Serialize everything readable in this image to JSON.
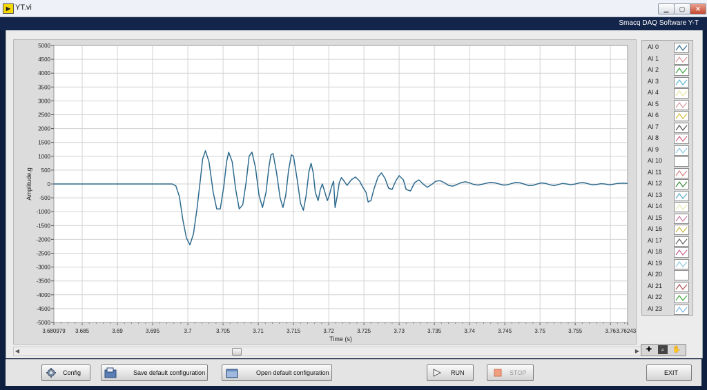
{
  "window": {
    "title": "YT.vi",
    "app_icon": "labview-vi-icon"
  },
  "header": {
    "app_name": "Smacq DAQ Software Y-T"
  },
  "chart_data": {
    "type": "line",
    "xlabel": "Time (s)",
    "ylabel": "Amplitude,g",
    "xlim": [
      3.680979,
      3.762431
    ],
    "ylim": [
      -5000,
      5000
    ],
    "x_ticks": [
      "3.680979",
      "3.685",
      "3.69",
      "3.695",
      "3.7",
      "3.705",
      "3.71",
      "3.715",
      "3.72",
      "3.725",
      "3.73",
      "3.735",
      "3.74",
      "3.745",
      "3.75",
      "3.755",
      "3.76",
      "3.762431"
    ],
    "y_ticks": [
      "5000",
      "4500",
      "4000",
      "3500",
      "3000",
      "2500",
      "2000",
      "1500",
      "1000",
      "500",
      "0",
      "-500",
      "-1000",
      "-1500",
      "-2000",
      "-2500",
      "-3000",
      "-3500",
      "-4000",
      "-4500",
      "-5000"
    ],
    "grid": true,
    "series": [
      {
        "name": "AI 0",
        "color": "#2d6a8e",
        "points": [
          [
            3.680979,
            0
          ],
          [
            3.69,
            0
          ],
          [
            3.6978,
            0
          ],
          [
            3.6983,
            -70
          ],
          [
            3.6988,
            -450
          ],
          [
            3.6993,
            -1300
          ],
          [
            3.6998,
            -1950
          ],
          [
            3.7003,
            -2200
          ],
          [
            3.7008,
            -1800
          ],
          [
            3.7013,
            -900
          ],
          [
            3.7018,
            200
          ],
          [
            3.7021,
            900
          ],
          [
            3.7025,
            1200
          ],
          [
            3.703,
            800
          ],
          [
            3.7036,
            -300
          ],
          [
            3.7041,
            -900
          ],
          [
            3.7046,
            -900
          ],
          [
            3.7051,
            -100
          ],
          [
            3.7055,
            800
          ],
          [
            3.7058,
            1150
          ],
          [
            3.7063,
            800
          ],
          [
            3.7068,
            -200
          ],
          [
            3.7073,
            -900
          ],
          [
            3.7078,
            -750
          ],
          [
            3.7083,
            100
          ],
          [
            3.7087,
            1000
          ],
          [
            3.7091,
            1150
          ],
          [
            3.7096,
            600
          ],
          [
            3.7101,
            -400
          ],
          [
            3.7106,
            -850
          ],
          [
            3.7111,
            -300
          ],
          [
            3.7115,
            600
          ],
          [
            3.7118,
            1050
          ],
          [
            3.7121,
            1100
          ],
          [
            3.7126,
            400
          ],
          [
            3.7131,
            -500
          ],
          [
            3.7135,
            -850
          ],
          [
            3.7139,
            -400
          ],
          [
            3.7143,
            500
          ],
          [
            3.7147,
            1050
          ],
          [
            3.715,
            1000
          ],
          [
            3.7155,
            200
          ],
          [
            3.716,
            -700
          ],
          [
            3.7164,
            -950
          ],
          [
            3.7168,
            -400
          ],
          [
            3.7172,
            450
          ],
          [
            3.7175,
            750
          ],
          [
            3.7178,
            400
          ],
          [
            3.7181,
            -300
          ],
          [
            3.7185,
            -600
          ],
          [
            3.7188,
            -200
          ],
          [
            3.7191,
            0
          ],
          [
            3.7194,
            -250
          ],
          [
            3.7198,
            -600
          ],
          [
            3.7201,
            -400
          ],
          [
            3.7204,
            -100
          ],
          [
            3.7207,
            100
          ],
          [
            3.7209,
            -850
          ],
          [
            3.7212,
            -450
          ],
          [
            3.7215,
            50
          ],
          [
            3.7218,
            230
          ],
          [
            3.7222,
            100
          ],
          [
            3.7226,
            -50
          ],
          [
            3.7232,
            150
          ],
          [
            3.7238,
            250
          ],
          [
            3.7244,
            100
          ],
          [
            3.7248,
            -100
          ],
          [
            3.7253,
            -300
          ],
          [
            3.7256,
            -650
          ],
          [
            3.726,
            -600
          ],
          [
            3.7264,
            -200
          ],
          [
            3.727,
            250
          ],
          [
            3.7275,
            400
          ],
          [
            3.728,
            200
          ],
          [
            3.7285,
            -150
          ],
          [
            3.729,
            -200
          ],
          [
            3.7295,
            100
          ],
          [
            3.73,
            300
          ],
          [
            3.7306,
            150
          ],
          [
            3.731,
            -200
          ],
          [
            3.7316,
            -250
          ],
          [
            3.7322,
            50
          ],
          [
            3.7328,
            150
          ],
          [
            3.7334,
            0
          ],
          [
            3.734,
            -120
          ],
          [
            3.7346,
            -20
          ],
          [
            3.7352,
            100
          ],
          [
            3.7358,
            120
          ],
          [
            3.7364,
            50
          ],
          [
            3.737,
            -50
          ],
          [
            3.7376,
            -80
          ],
          [
            3.7382,
            -20
          ],
          [
            3.7388,
            50
          ],
          [
            3.7394,
            80
          ],
          [
            3.74,
            40
          ],
          [
            3.7406,
            -20
          ],
          [
            3.7412,
            -40
          ],
          [
            3.7418,
            -10
          ],
          [
            3.7424,
            30
          ],
          [
            3.743,
            60
          ],
          [
            3.7436,
            40
          ],
          [
            3.7442,
            0
          ],
          [
            3.7448,
            -40
          ],
          [
            3.7454,
            -30
          ],
          [
            3.746,
            20
          ],
          [
            3.7466,
            60
          ],
          [
            3.7472,
            40
          ],
          [
            3.7478,
            -10
          ],
          [
            3.7484,
            -60
          ],
          [
            3.749,
            -50
          ],
          [
            3.7496,
            0
          ],
          [
            3.7502,
            40
          ],
          [
            3.7508,
            20
          ],
          [
            3.7514,
            -30
          ],
          [
            3.752,
            -60
          ],
          [
            3.7526,
            -20
          ],
          [
            3.7532,
            20
          ],
          [
            3.7538,
            0
          ],
          [
            3.7544,
            -30
          ],
          [
            3.755,
            0
          ],
          [
            3.7556,
            40
          ],
          [
            3.7562,
            50
          ],
          [
            3.7568,
            10
          ],
          [
            3.7574,
            -30
          ],
          [
            3.758,
            -20
          ],
          [
            3.7586,
            10
          ],
          [
            3.7592,
            0
          ],
          [
            3.7598,
            -30
          ],
          [
            3.7604,
            -10
          ],
          [
            3.761,
            20
          ],
          [
            3.7618,
            30
          ],
          [
            3.762431,
            20
          ]
        ]
      }
    ]
  },
  "legend": {
    "channels": [
      {
        "name": "AI 0",
        "color": "#2d6a8e"
      },
      {
        "name": "AI 1",
        "color": "#d89090"
      },
      {
        "name": "AI 2",
        "color": "#3aa43a"
      },
      {
        "name": "AI 3",
        "color": "#5ab8d8"
      },
      {
        "name": "AI 4",
        "color": "#e6e6a0"
      },
      {
        "name": "AI 5",
        "color": "#d89aa0"
      },
      {
        "name": "AI 6",
        "color": "#d8c040"
      },
      {
        "name": "AI 7",
        "color": "#505050"
      },
      {
        "name": "AI 8",
        "color": "#d06080"
      },
      {
        "name": "AI 9",
        "color": "#88c8e8"
      },
      {
        "name": "AI 10",
        "color": "#ffffff"
      },
      {
        "name": "AI 11",
        "color": "#d88080"
      },
      {
        "name": "AI 12",
        "color": "#3a8a3a"
      },
      {
        "name": "AI 13",
        "color": "#5aa8c8"
      },
      {
        "name": "AI 14",
        "color": "#e8e8b0"
      },
      {
        "name": "AI 15",
        "color": "#c878a0"
      },
      {
        "name": "AI 16",
        "color": "#c8b840"
      },
      {
        "name": "AI 17",
        "color": "#606060"
      },
      {
        "name": "AI 18",
        "color": "#c86090"
      },
      {
        "name": "AI 19",
        "color": "#90c8e0"
      },
      {
        "name": "AI 20",
        "color": "#ffffff"
      },
      {
        "name": "AI 21",
        "color": "#b05050"
      },
      {
        "name": "AI 22",
        "color": "#40a840"
      },
      {
        "name": "AI 23",
        "color": "#7ab8e0"
      }
    ]
  },
  "palette": {
    "tools": [
      "cursor-move-icon",
      "zoom-icon",
      "pan-hand-icon"
    ]
  },
  "buttons": {
    "config": "Config",
    "save": "Save default configuration",
    "open": "Open default configuration",
    "run": "RUN",
    "stop": "STOP",
    "exit": "EXIT"
  }
}
